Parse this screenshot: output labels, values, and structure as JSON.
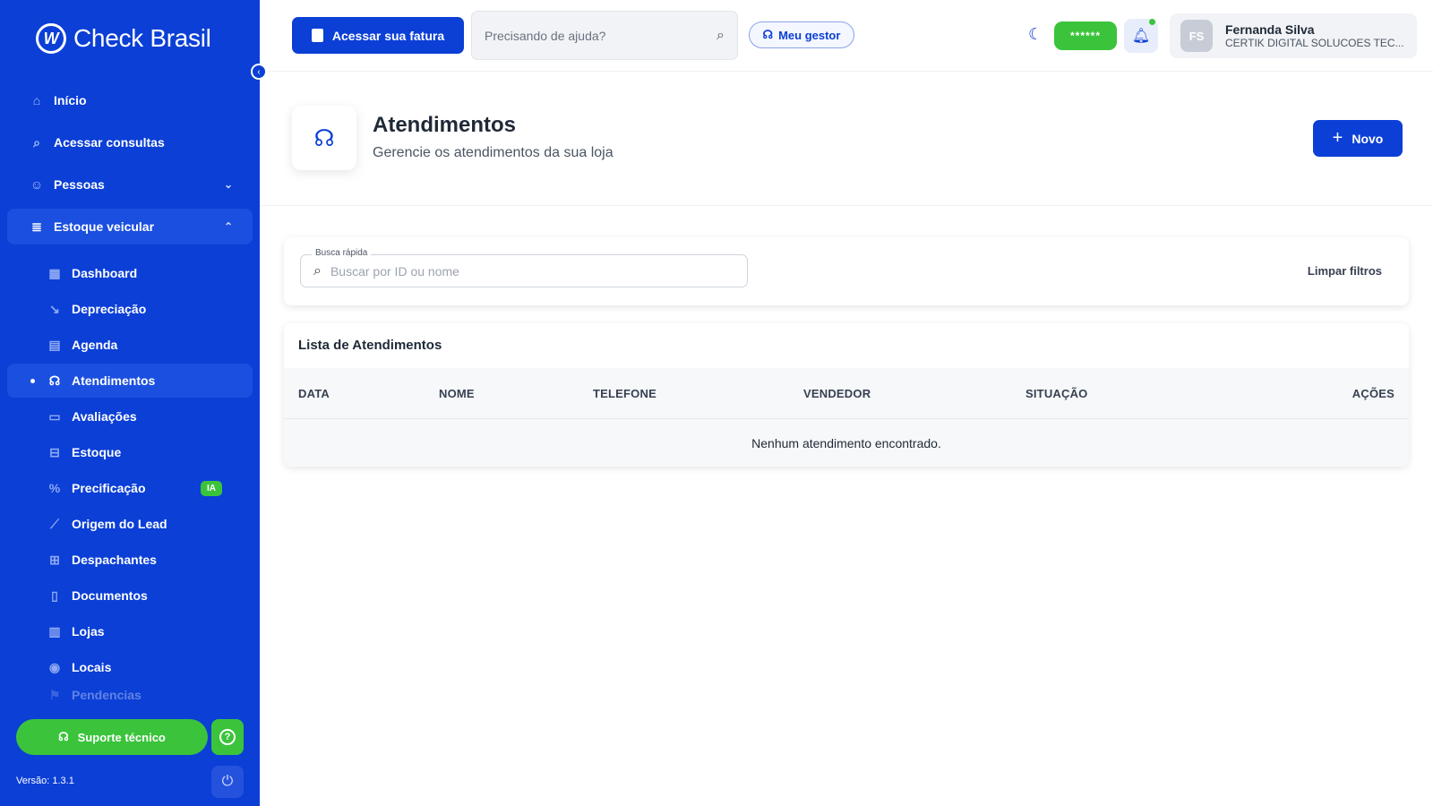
{
  "brand": {
    "name": "Check Brasil",
    "mark": "W"
  },
  "sidebar": {
    "items": [
      {
        "label": "Início",
        "icon": "home-icon"
      },
      {
        "label": "Acessar consultas",
        "icon": "search-icon"
      },
      {
        "label": "Pessoas",
        "icon": "people-icon"
      },
      {
        "label": "Estoque veicular",
        "icon": "stock-icon"
      }
    ],
    "subitems": [
      {
        "label": "Dashboard",
        "icon": "dashboard-icon"
      },
      {
        "label": "Depreciação",
        "icon": "trend-down-icon"
      },
      {
        "label": "Agenda",
        "icon": "calendar-icon"
      },
      {
        "label": "Atendimentos",
        "icon": "headset-icon"
      },
      {
        "label": "Avaliações",
        "icon": "archive-icon"
      },
      {
        "label": "Estoque",
        "icon": "car-icon"
      },
      {
        "label": "Precificação",
        "icon": "percent-icon",
        "badge": "IA"
      },
      {
        "label": "Origem do Lead",
        "icon": "chart-line-icon"
      },
      {
        "label": "Despachantes",
        "icon": "truck-icon"
      },
      {
        "label": "Documentos",
        "icon": "document-icon"
      },
      {
        "label": "Lojas",
        "icon": "store-icon"
      },
      {
        "label": "Locais",
        "icon": "location-pin-icon"
      },
      {
        "label": "Pendencias",
        "icon": "flag-icon"
      }
    ],
    "support_label": "Suporte técnico",
    "version": "Versão: 1.3.1"
  },
  "topbar": {
    "fatura_label": "Acessar sua fatura",
    "help_placeholder": "Precisando de ajuda?",
    "gestor_label": "Meu gestor",
    "masked_pill": "******",
    "user": {
      "initials": "FS",
      "name": "Fernanda Silva",
      "company": "CERTIK DIGITAL SOLUCOES TEC..."
    }
  },
  "page": {
    "title": "Atendimentos",
    "subtitle": "Gerencie os atendimentos da sua loja",
    "new_label": "Novo"
  },
  "filters": {
    "search_label": "Busca rápida",
    "search_placeholder": "Buscar por ID ou nome",
    "clear_label": "Limpar filtros"
  },
  "table": {
    "title": "Lista de Atendimentos",
    "columns": [
      "DATA",
      "NOME",
      "TELEFONE",
      "VENDEDOR",
      "SITUAÇÃO",
      "AÇÕES"
    ],
    "empty_message": "Nenhum atendimento encontrado."
  },
  "colors": {
    "primary": "#0b3fd6",
    "accent_green": "#3bc43b"
  }
}
